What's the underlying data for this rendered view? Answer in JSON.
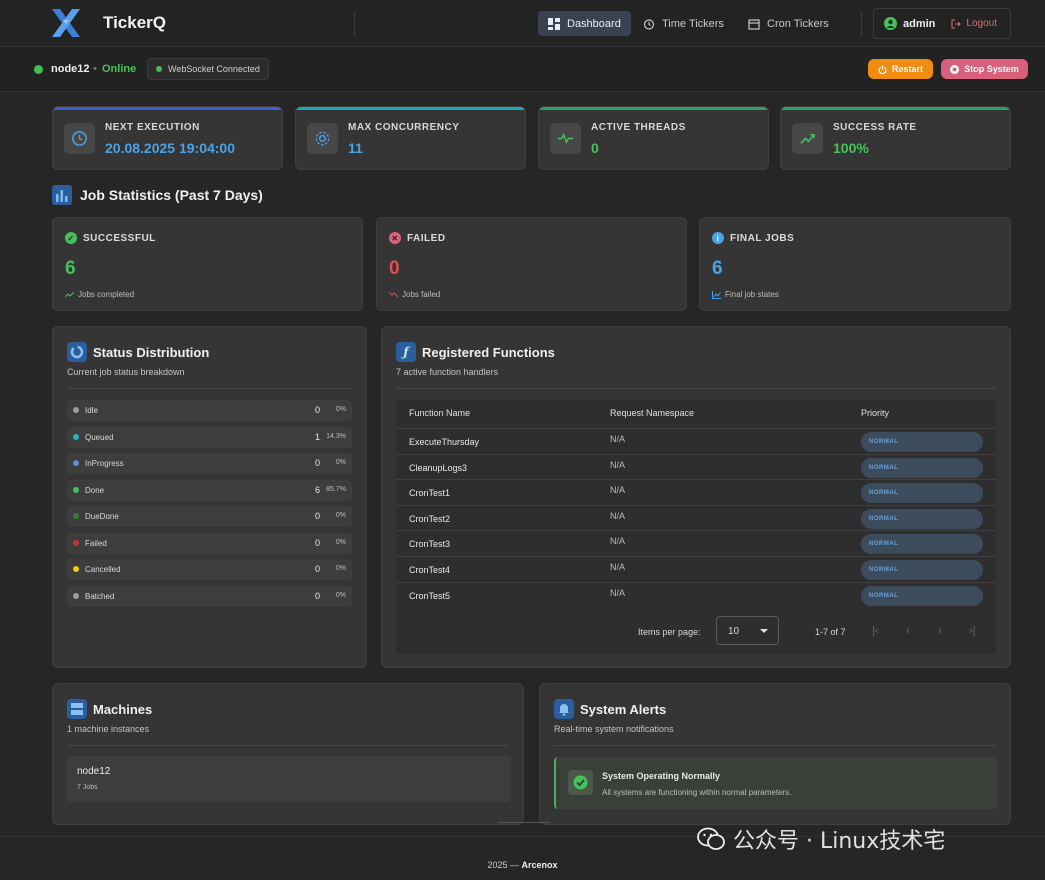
{
  "app": {
    "name": "TickerQ"
  },
  "nav": {
    "dashboard": "Dashboard",
    "time_tickers": "Time Tickers",
    "cron_tickers": "Cron Tickers"
  },
  "user": {
    "name": "admin",
    "logout": "Logout"
  },
  "status": {
    "node": "node12",
    "separator": "•",
    "state": "Online",
    "websocket": "WebSocket Connected",
    "restart": "Restart",
    "stop": "Stop System"
  },
  "metrics": [
    {
      "label": "NEXT EXECUTION",
      "value": "20.08.2025 19:04:00",
      "color": "#4aa3e6",
      "icon": "clock-icon"
    },
    {
      "label": "MAX CONCURRENCY",
      "value": "11",
      "color": "#4aa3e6",
      "icon": "gear-icon"
    },
    {
      "label": "ACTIVE THREADS",
      "value": "0",
      "color": "#45c25a",
      "icon": "pulse-icon"
    },
    {
      "label": "SUCCESS RATE",
      "value": "100%",
      "color": "#45c25a",
      "icon": "trend-icon"
    }
  ],
  "job_stats": {
    "title": "Job Statistics (Past 7 Days)",
    "cards": [
      {
        "label": "SUCCESSFUL",
        "value": "6",
        "sub": "Jobs completed",
        "color": "#45c25a"
      },
      {
        "label": "FAILED",
        "value": "0",
        "sub": "Jobs failed",
        "color": "#e0504f"
      },
      {
        "label": "FINAL JOBS",
        "value": "6",
        "sub": "Final job states",
        "color": "#4aa3e6"
      }
    ]
  },
  "status_distribution": {
    "title": "Status Distribution",
    "subtitle": "Current job status breakdown",
    "rows": [
      {
        "name": "Idle",
        "count": "0",
        "pct": "0%",
        "color": "#9e9e9e"
      },
      {
        "name": "Queued",
        "count": "1",
        "pct": "14.3%",
        "color": "#1fb7c9"
      },
      {
        "name": "InProgress",
        "count": "0",
        "pct": "0%",
        "color": "#5b8fd6"
      },
      {
        "name": "Done",
        "count": "6",
        "pct": "85.7%",
        "color": "#45c25a"
      },
      {
        "name": "DueDone",
        "count": "0",
        "pct": "0%",
        "color": "#2e7d32"
      },
      {
        "name": "Failed",
        "count": "0",
        "pct": "0%",
        "color": "#d32f2f"
      },
      {
        "name": "Cancelled",
        "count": "0",
        "pct": "0%",
        "color": "#f5d000"
      },
      {
        "name": "Batched",
        "count": "0",
        "pct": "0%",
        "color": "#9e9e9e"
      }
    ]
  },
  "functions": {
    "title": "Registered Functions",
    "subtitle": "7 active function handlers",
    "columns": [
      "Function Name",
      "Request Namespace",
      "Priority"
    ],
    "rows": [
      {
        "name": "ExecuteThursday",
        "namespace": "N/A",
        "priority": "NORMAL"
      },
      {
        "name": "CleanupLogs3",
        "namespace": "N/A",
        "priority": "NORMAL"
      },
      {
        "name": "CronTest1",
        "namespace": "N/A",
        "priority": "NORMAL"
      },
      {
        "name": "CronTest2",
        "namespace": "N/A",
        "priority": "NORMAL"
      },
      {
        "name": "CronTest3",
        "namespace": "N/A",
        "priority": "NORMAL"
      },
      {
        "name": "CronTest4",
        "namespace": "N/A",
        "priority": "NORMAL"
      },
      {
        "name": "CronTest5",
        "namespace": "N/A",
        "priority": "NORMAL"
      }
    ],
    "pager": {
      "label": "Items per page:",
      "per_page": "10",
      "range": "1-7 of 7"
    }
  },
  "machines": {
    "title": "Machines",
    "subtitle": "1 machine instances",
    "items": [
      {
        "name": "node12",
        "jobs": "7 Jobs"
      }
    ]
  },
  "alerts": {
    "title": "System Alerts",
    "subtitle": "Real-time system notifications",
    "item": {
      "title": "System Operating Normally",
      "text": "All systems are functioning within normal parameters."
    }
  },
  "footer": {
    "year": "2025 —",
    "brand": "Arcenox"
  },
  "watermark": "公众号 · Linux技术宅"
}
